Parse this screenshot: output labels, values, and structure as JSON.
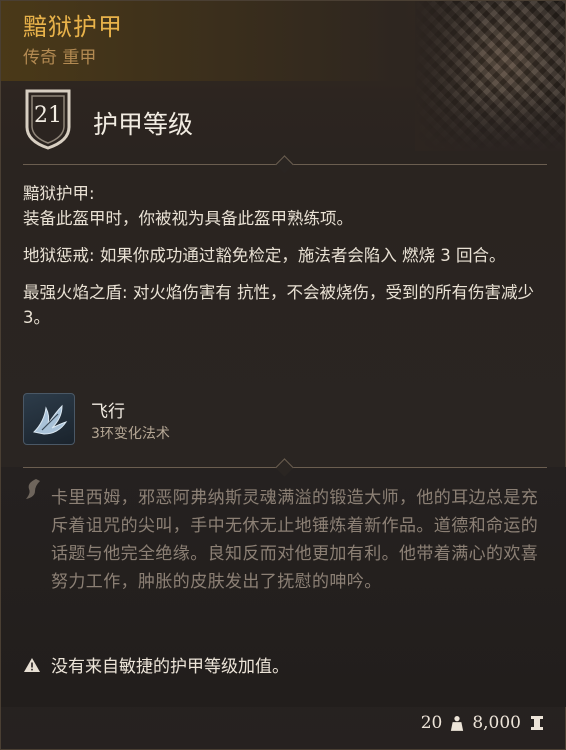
{
  "item": {
    "name": "黯狱护甲",
    "rarity": "传奇",
    "type": "重甲",
    "armor_class": "21",
    "armor_class_label": "护甲等级"
  },
  "properties": [
    {
      "title": "黯狱护甲:",
      "text": "装备此盔甲时，你被视为具备此盔甲熟练项。"
    },
    {
      "title": "地狱惩戒:",
      "text": "如果你成功通过豁免检定，施法者会陷入 燃烧 3 回合。"
    },
    {
      "title": "最强火焰之盾:",
      "text": "对火焰伤害有 抗性，不会被烧伤，受到的所有伤害减少 3。"
    }
  ],
  "spell": {
    "name": "飞行",
    "level": "3环变化法术",
    "icon": "wing-icon"
  },
  "flavor_text": "卡里西姆，邪恶阿弗纳斯灵魂满溢的锻造大师，他的耳边总是充斥着诅咒的尖叫，手中无休无止地锤炼着新作品。道德和命运的话题与他完全绝缘。良知反而对他更加有利。他带着满心的欢喜努力工作，肿胀的皮肤发出了抚慰的呻吟。",
  "warning": "没有来自敏捷的护甲等级加值。",
  "footer": {
    "weight": "20",
    "weight_icon": "weight-icon",
    "value": "8,000",
    "value_icon": "gold-coin-icon"
  },
  "colors": {
    "item_name": "#e8b24a",
    "rarity": "#b38a52",
    "flavor": "#8c8075"
  }
}
